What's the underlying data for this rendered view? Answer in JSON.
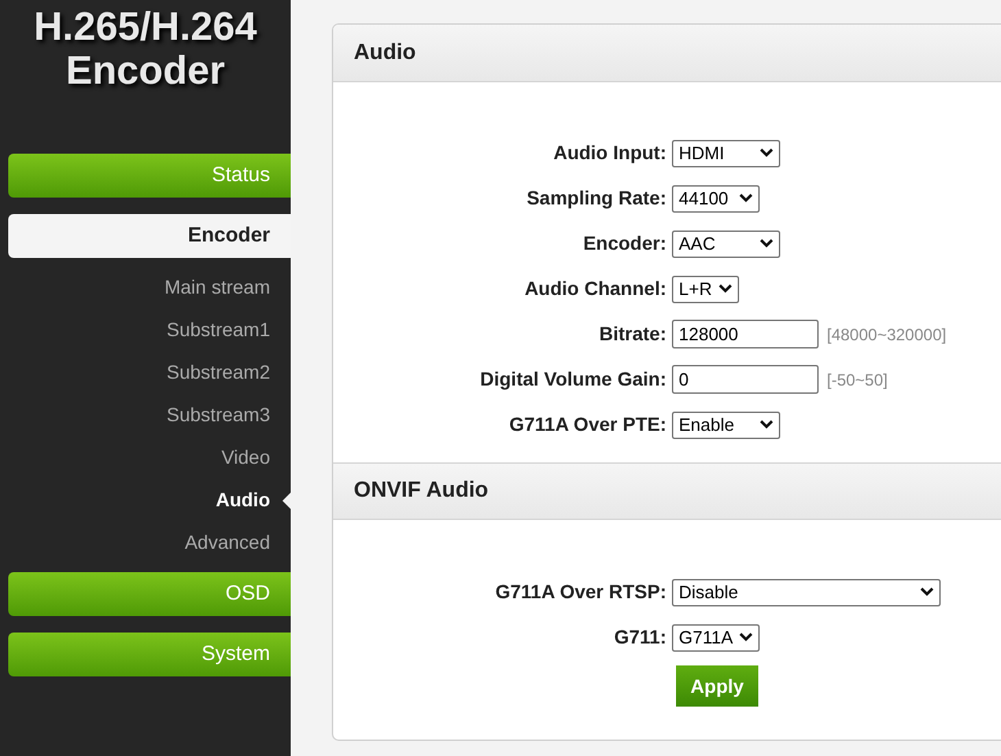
{
  "logo": {
    "line1": "H.265/H.264",
    "line2": "Encoder"
  },
  "sidebar": {
    "items": [
      {
        "kind": "group",
        "label": "Status",
        "selected": false
      },
      {
        "kind": "group",
        "label": "Encoder",
        "selected": true
      },
      {
        "kind": "sub",
        "label": "Main stream",
        "selected": false
      },
      {
        "kind": "sub",
        "label": "Substream1",
        "selected": false
      },
      {
        "kind": "sub",
        "label": "Substream2",
        "selected": false
      },
      {
        "kind": "sub",
        "label": "Substream3",
        "selected": false
      },
      {
        "kind": "sub",
        "label": "Video",
        "selected": false
      },
      {
        "kind": "sub",
        "label": "Audio",
        "selected": true
      },
      {
        "kind": "sub",
        "label": "Advanced",
        "selected": false
      },
      {
        "kind": "group",
        "label": "OSD",
        "selected": false
      },
      {
        "kind": "group",
        "label": "System",
        "selected": false
      }
    ]
  },
  "sections": [
    {
      "title": "Audio",
      "fields": [
        {
          "kind": "select",
          "label": "Audio Input:",
          "value": "HDMI"
        },
        {
          "kind": "select",
          "label": "Sampling Rate:",
          "value": "44100"
        },
        {
          "kind": "select",
          "label": "Encoder:",
          "value": "AAC"
        },
        {
          "kind": "select",
          "label": "Audio Channel:",
          "value": "L+R"
        },
        {
          "kind": "input",
          "label": "Bitrate:",
          "value": "128000",
          "hint": "[48000~320000]"
        },
        {
          "kind": "input",
          "label": "Digital Volume Gain:",
          "value": "0",
          "hint": "[-50~50]"
        },
        {
          "kind": "select",
          "label": "G711A Over PTE:",
          "value": "Enable"
        }
      ]
    },
    {
      "title": "ONVIF Audio",
      "fields": [
        {
          "kind": "select",
          "label": "G711A Over RTSP:",
          "value": "Disable"
        },
        {
          "kind": "select",
          "label": "G711:",
          "value": "G711A"
        }
      ],
      "button": "Apply"
    }
  ]
}
